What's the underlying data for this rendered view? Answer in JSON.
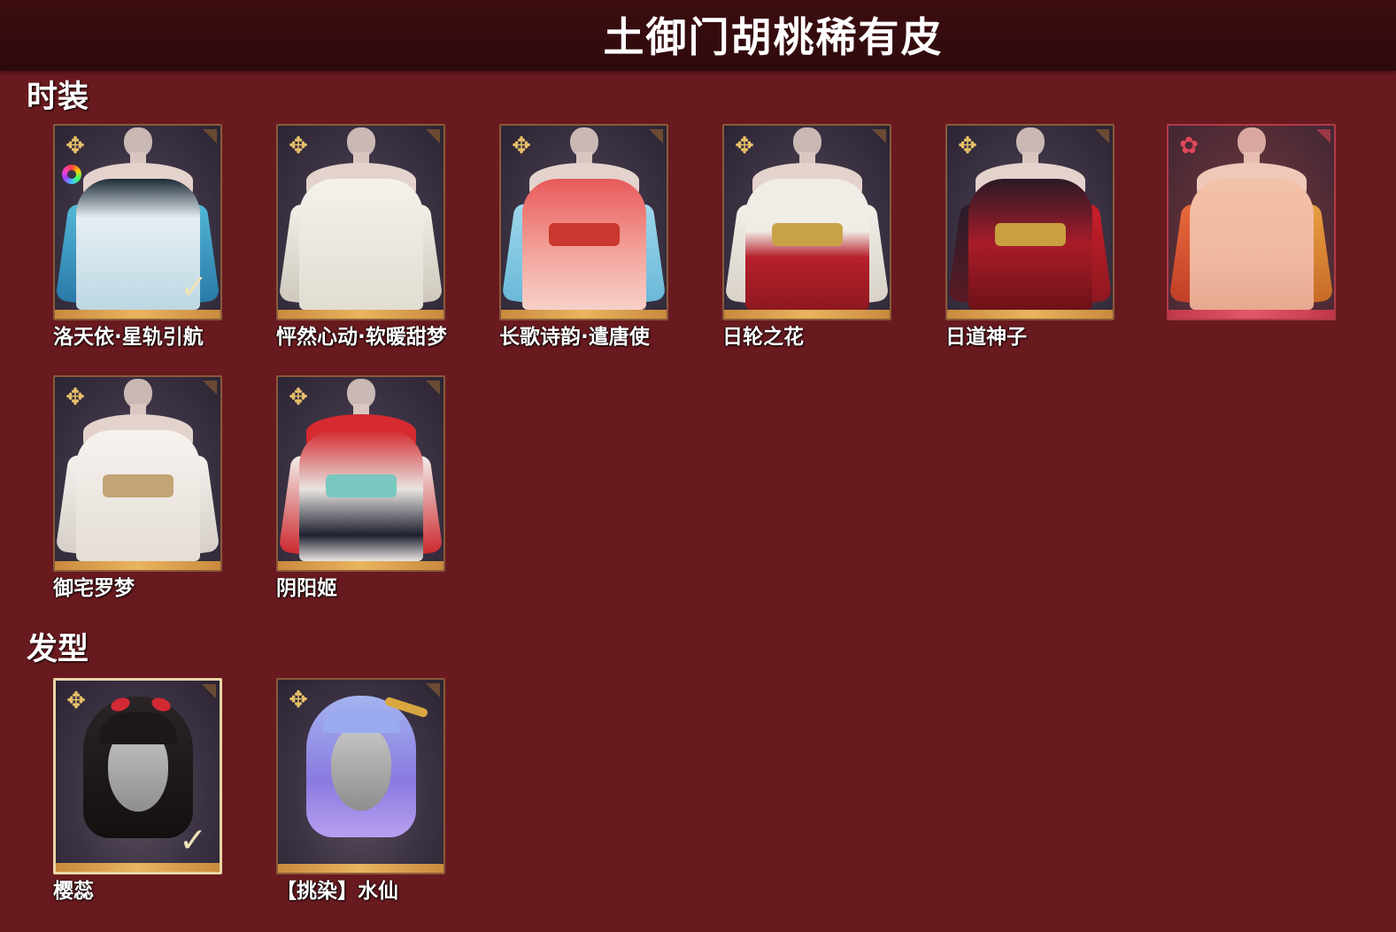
{
  "title": "土御门胡桃稀有皮",
  "sections": [
    {
      "label": "时装",
      "items": [
        {
          "name": "洛天依·星轨引航",
          "selected": true
        },
        {
          "name": "怦然心动·软暖甜梦",
          "selected": false
        },
        {
          "name": "长歌诗韵·遣唐使",
          "selected": false
        },
        {
          "name": "日轮之花",
          "selected": false
        },
        {
          "name": "日道神子",
          "selected": false
        },
        {
          "name": "",
          "selected": false
        },
        {
          "name": "御宅罗梦",
          "selected": false
        },
        {
          "name": "阴阳姬",
          "selected": false
        }
      ]
    },
    {
      "label": "发型",
      "items": [
        {
          "name": "樱蕊",
          "selected": true
        },
        {
          "name": "【挑染】水仙",
          "selected": false
        }
      ]
    }
  ],
  "icons": {
    "quality": "four-petal-star-icon",
    "quality_red": "red-flower-icon",
    "selected": "checkmark-icon",
    "dye": "rainbow-ring-icon",
    "corner": "corner-tag-icon"
  },
  "colors": {
    "background": "#681a1f",
    "title_bar": "#3c0d10",
    "gold_accent": "#e9b45f",
    "red_accent": "#e0586a"
  }
}
